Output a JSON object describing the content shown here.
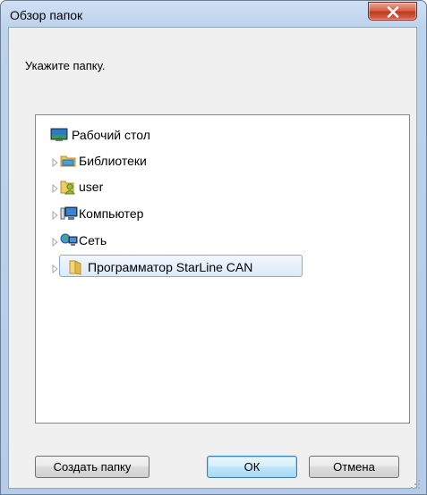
{
  "window": {
    "title": "Обзор папок",
    "prompt": "Укажите папку."
  },
  "tree": {
    "items": [
      {
        "label": "Рабочий стол",
        "icon": "desktop-icon",
        "expandable": false,
        "selected": false
      },
      {
        "label": "Библиотеки",
        "icon": "libraries-icon",
        "expandable": true,
        "selected": false
      },
      {
        "label": "user",
        "icon": "user-folder-icon",
        "expandable": true,
        "selected": false
      },
      {
        "label": "Компьютер",
        "icon": "computer-icon",
        "expandable": true,
        "selected": false
      },
      {
        "label": "Сеть",
        "icon": "network-icon",
        "expandable": true,
        "selected": false
      },
      {
        "label": "Программатор StarLine CAN",
        "icon": "folder-icon",
        "expandable": true,
        "selected": true
      }
    ]
  },
  "buttons": {
    "new_folder_label": "Создать папку",
    "ok_label": "ОК",
    "cancel_label": "Отмена"
  },
  "colors": {
    "frame": "#b4cce8",
    "close_button": "#c2391c",
    "selection": "#dceaf9",
    "selection_border": "#84acdd"
  }
}
